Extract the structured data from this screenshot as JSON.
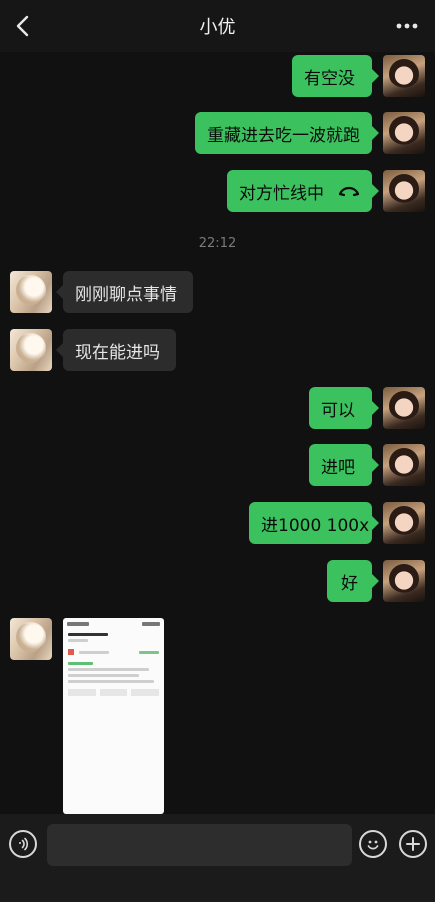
{
  "header": {
    "title": "小优",
    "back_icon": "chevron-left-icon",
    "more_icon": "more-dots-icon"
  },
  "messages": [
    {
      "side": "me",
      "text": "有空没"
    },
    {
      "side": "me",
      "text": "重藏进去吃一波就跑"
    },
    {
      "side": "me",
      "text": "对方忙线中",
      "icon": "phone-hangup-icon"
    },
    {
      "type": "time",
      "text": "22:12"
    },
    {
      "side": "other",
      "text": "刚刚聊点事情"
    },
    {
      "side": "other",
      "text": "现在能进吗"
    },
    {
      "side": "me",
      "text": "可以"
    },
    {
      "side": "me",
      "text": "进吧"
    },
    {
      "side": "me",
      "text": "进1000 100x"
    },
    {
      "side": "me",
      "text": "好"
    },
    {
      "side": "other",
      "type": "image"
    }
  ],
  "input_bar": {
    "voice_icon": "voice-icon",
    "emoji_icon": "emoji-icon",
    "plus_icon": "plus-icon",
    "placeholder": ""
  },
  "colors": {
    "background": "#111111",
    "my_bubble": "#3cc15f",
    "other_bubble": "#2c2c2c"
  }
}
